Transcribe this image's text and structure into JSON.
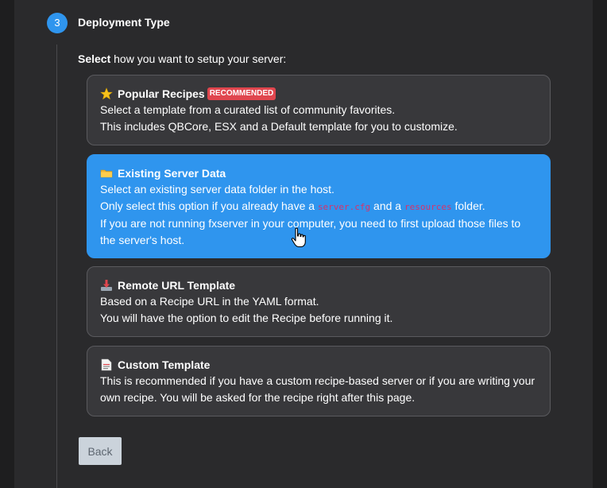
{
  "step": {
    "number": "3",
    "title": "Deployment Type"
  },
  "prompt": {
    "bold": "Select",
    "rest": " how you want to setup your server:"
  },
  "options": [
    {
      "icon": "star-icon",
      "title": "Popular Recipes",
      "badge": "RECOMMENDED",
      "lines": [
        "Select a template from a curated list of community favorites.",
        "This includes QBCore, ESX and a Default template for you to customize."
      ]
    },
    {
      "icon": "folder-icon",
      "title": "Existing Server Data",
      "selected": true,
      "line1": "Select an existing server data folder in the host.",
      "line2_a": "Only select this option if you already have a ",
      "line2_code1": "server.cfg",
      "line2_b": " and a ",
      "line2_code2": "resources",
      "line2_c": " folder.",
      "line3": "If you are not running fxserver in your computer, you need to first upload those files to",
      "line4": "the server's host."
    },
    {
      "icon": "download-icon",
      "title": "Remote URL Template",
      "lines": [
        "Based on a Recipe URL in the YAML format.",
        "You will have the option to edit the Recipe before running it."
      ]
    },
    {
      "icon": "document-icon",
      "title": "Custom Template",
      "lines": [
        "This is recommended if you have a custom recipe-based server or if you are writing your",
        "own recipe. You will be asked for the recipe right after this page."
      ]
    }
  ],
  "back_label": "Back",
  "colors": {
    "accent": "#2f95ee",
    "badge": "#e0464e",
    "card": "#38383b",
    "panel": "#2a2a2c"
  }
}
